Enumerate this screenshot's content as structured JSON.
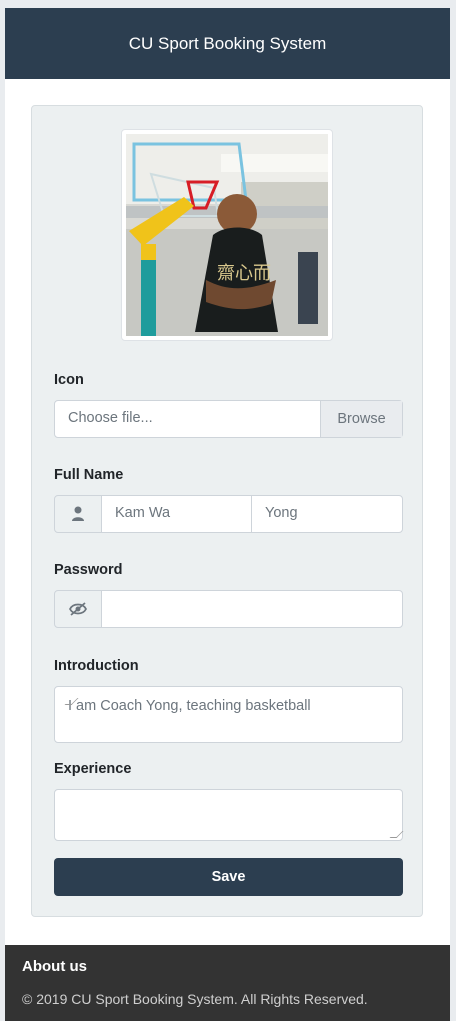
{
  "header": {
    "title": "CU Sport Booking System"
  },
  "form": {
    "icon_label": "Icon",
    "file_placeholder": "Choose file...",
    "browse_label": "Browse",
    "full_name_label": "Full Name",
    "first_name": "Kam Wa",
    "last_name": "Yong",
    "password_label": "Password",
    "introduction_label": "Introduction",
    "introduction_value": "I am Coach Yong, teaching basketball",
    "experience_label": "Experience",
    "experience_value": "",
    "save_label": "Save"
  },
  "icons": {
    "name_prefix": "user-icon",
    "password_prefix": "eye-slash-icon"
  },
  "footer": {
    "about": "About us",
    "copyright": "© 2019 CU Sport Booking System. All Rights Reserved."
  }
}
